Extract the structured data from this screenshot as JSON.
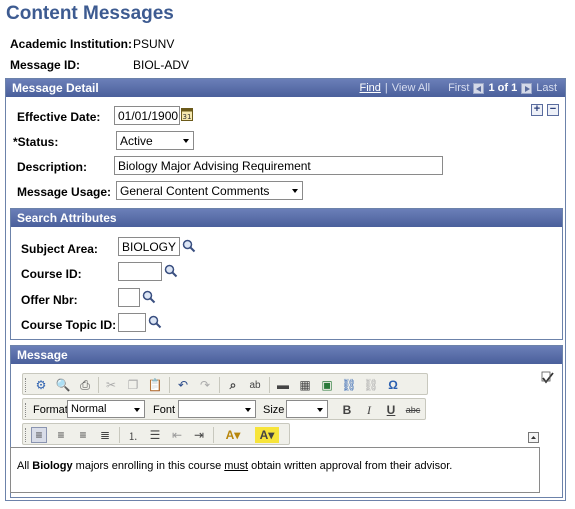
{
  "page": {
    "title": "Content Messages"
  },
  "keys": {
    "institution_label": "Academic Institution:",
    "institution_value": "PSUNV",
    "message_id_label": "Message ID:",
    "message_id_value": "BIOL-ADV"
  },
  "detail": {
    "header": "Message Detail",
    "nav": {
      "find": "Find",
      "sep": "|",
      "view_all": "View All",
      "first": "First",
      "count": "1 of 1",
      "last": "Last"
    },
    "effective_date_label": "Effective Date:",
    "effective_date_value": "01/01/1900",
    "status_label": "*Status:",
    "status_value": "Active",
    "description_label": "Description:",
    "description_value": "Biology Major Advising Requirement",
    "usage_label": "Message Usage:",
    "usage_value": "General Content Comments",
    "add_symbol": "+",
    "remove_symbol": "−"
  },
  "search": {
    "header": "Search Attributes",
    "subject_label": "Subject Area:",
    "subject_value": "BIOLOGY",
    "course_label": "Course ID:",
    "course_value": "",
    "offer_label": "Offer Nbr:",
    "offer_value": "",
    "topic_label": "Course Topic ID:",
    "topic_value": ""
  },
  "message": {
    "header": "Message",
    "toolbar": {
      "format_label": "Format",
      "format_value": "Normal",
      "font_label": "Font",
      "font_value": "",
      "size_label": "Size",
      "size_value": "",
      "bold": "B",
      "italic": "I",
      "underline": "U",
      "strike": "abc",
      "omega": "Ω"
    },
    "body": {
      "t1": "All ",
      "t2": "Biology",
      "t3": " majors enrolling in this course ",
      "t4": "must",
      "t5": " obtain written approval from their advisor."
    }
  },
  "colors": {
    "accent": "#3d5b91",
    "header_bg": "#5568a6"
  }
}
